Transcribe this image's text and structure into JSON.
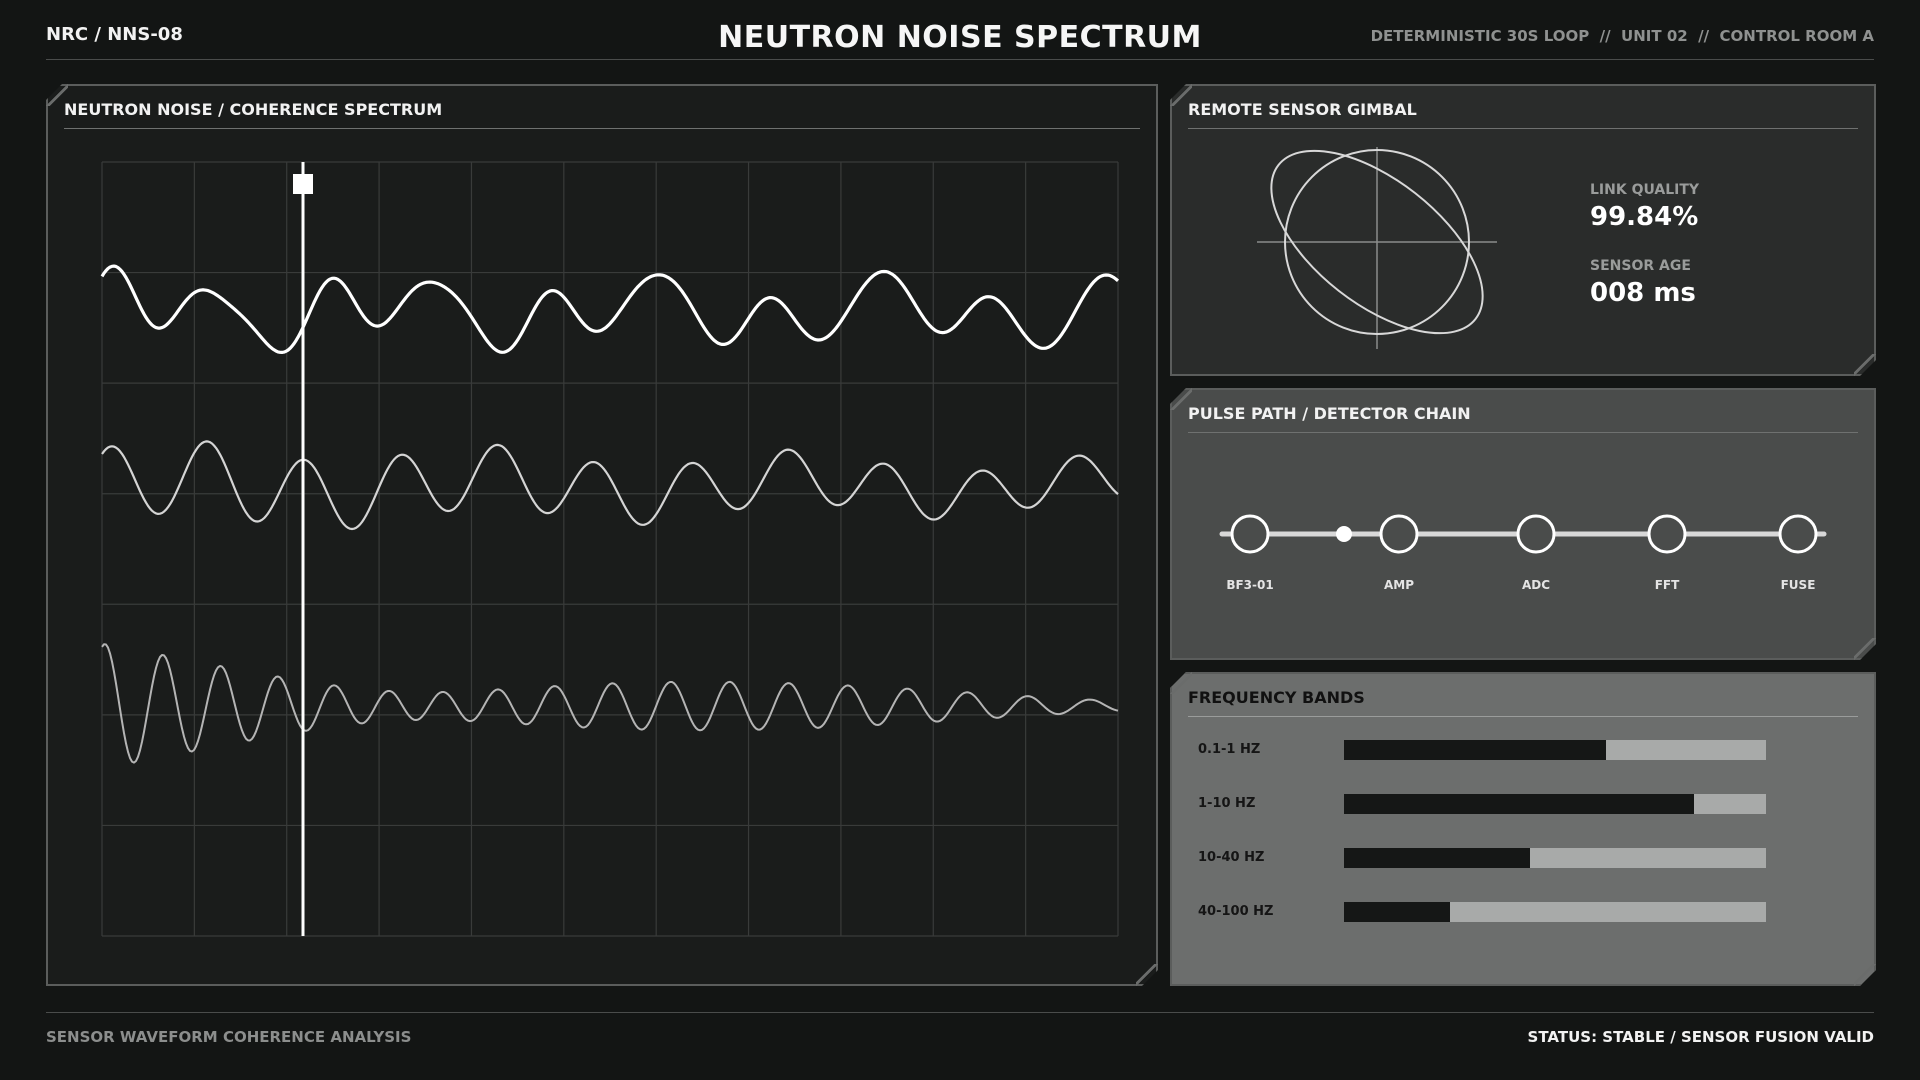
{
  "header": {
    "left": "NRC / NNS-08",
    "title": "NEUTRON NOISE SPECTRUM",
    "right": "DETERMINISTIC 30S LOOP  //  UNIT 02  //  CONTROL ROOM A"
  },
  "footer": {
    "left": "SENSOR WAVEFORM COHERENCE ANALYSIS",
    "right": "STATUS: STABLE / SENSOR FUSION VALID"
  },
  "spectrum": {
    "title": "NEUTRON NOISE / COHERENCE SPECTRUM"
  },
  "gimbal": {
    "title": "REMOTE SENSOR GIMBAL",
    "link_quality_label": "LINK QUALITY",
    "link_quality_value": "99.84%",
    "sensor_age_label": "SENSOR AGE",
    "sensor_age_value": "008 ms"
  },
  "pulse": {
    "title": "PULSE PATH / DETECTOR CHAIN",
    "nodes": [
      "BF3-01",
      "AMP",
      "ADC",
      "FFT",
      "FUSE"
    ]
  },
  "bands": {
    "title": "FREQUENCY BANDS",
    "items": [
      {
        "label": "0.1-1 HZ",
        "fraction": 0.62
      },
      {
        "label": "1-10 HZ",
        "fraction": 0.83
      },
      {
        "label": "10-40 HZ",
        "fraction": 0.44
      },
      {
        "label": "40-100 HZ",
        "fraction": 0.25
      }
    ]
  },
  "colors": {
    "background": "#131514",
    "trace_primary": "#ffffff",
    "trace_secondary": "#d4d4d4",
    "trace_tertiary": "#b4b4b4"
  }
}
